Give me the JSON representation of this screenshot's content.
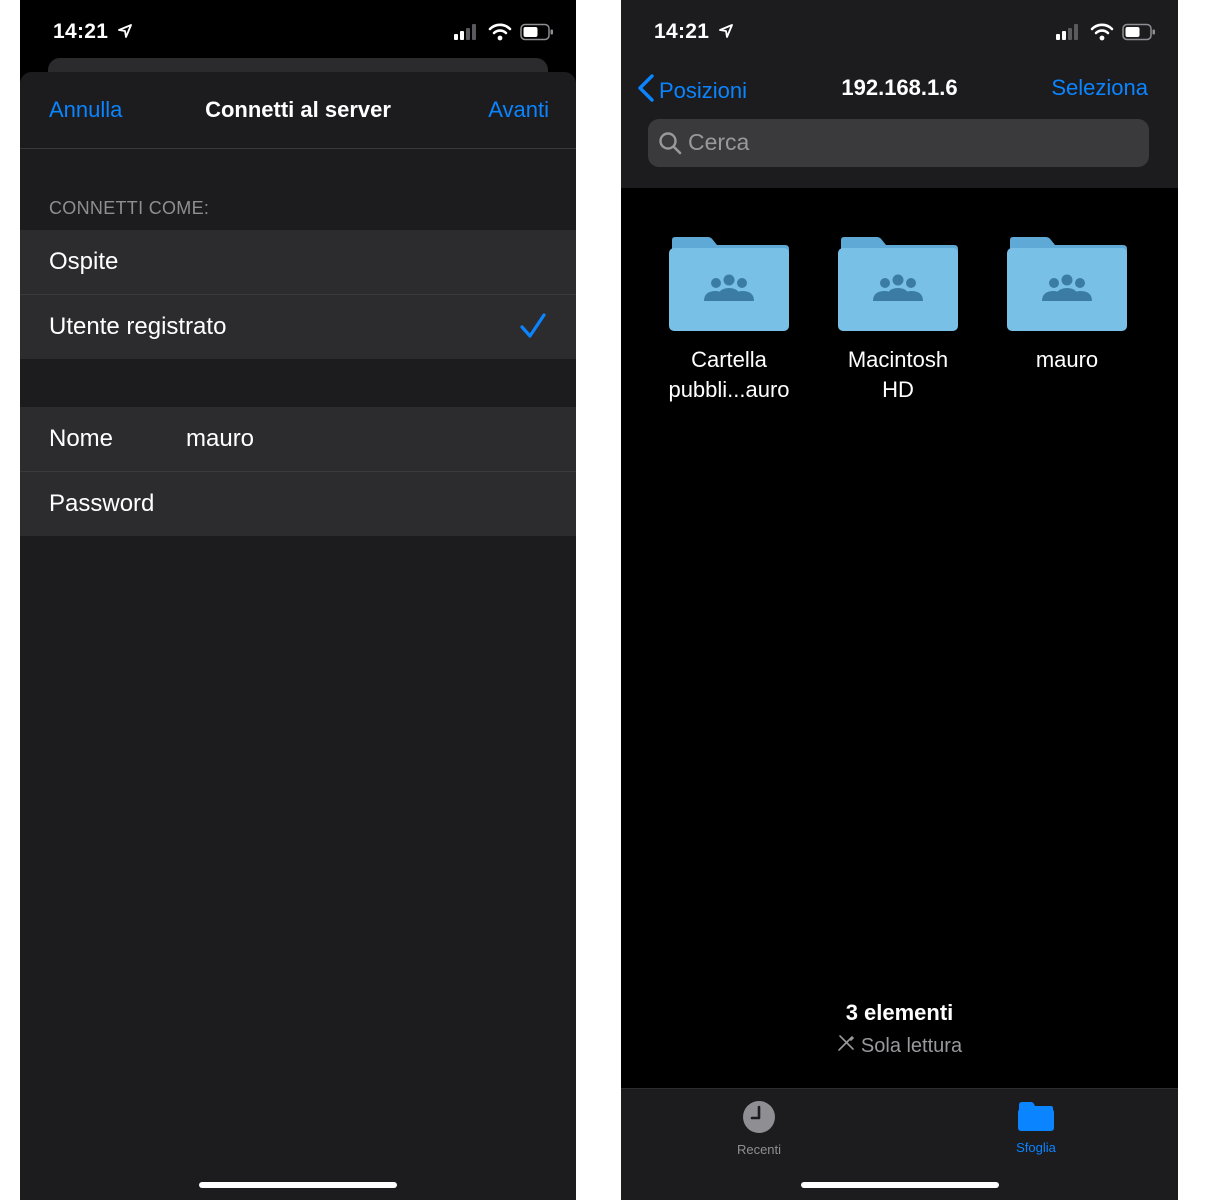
{
  "left_screen": {
    "status": {
      "time": "14:21"
    },
    "nav": {
      "cancel": "Annulla",
      "title": "Connetti al server",
      "next": "Avanti"
    },
    "section_header": "CONNETTI COME:",
    "options": [
      {
        "label": "Ospite",
        "selected": false
      },
      {
        "label": "Utente registrato",
        "selected": true
      }
    ],
    "credentials": {
      "name_label": "Nome",
      "name_value": "mauro",
      "password_label": "Password"
    },
    "colors": {
      "accent": "#0a84ff",
      "background": "#1c1c1e",
      "cell": "#2c2c2e"
    }
  },
  "right_screen": {
    "status": {
      "time": "14:21"
    },
    "nav": {
      "back": "Posizioni",
      "title": "192.168.1.6",
      "select": "Seleziona"
    },
    "search": {
      "placeholder": "Cerca"
    },
    "folders": [
      {
        "line1": "Cartella",
        "line2": "pubbli...auro",
        "icon": "shared-folder-icon"
      },
      {
        "line1": "Macintosh",
        "line2": "HD",
        "icon": "shared-folder-icon"
      },
      {
        "line1": "mauro",
        "line2": "",
        "icon": "shared-folder-icon"
      }
    ],
    "summary": {
      "count": "3 elementi",
      "read_only": "Sola lettura"
    },
    "tabs": [
      {
        "label": "Recenti",
        "icon": "clock-icon",
        "active": false
      },
      {
        "label": "Sfoglia",
        "icon": "folder-icon",
        "active": true
      }
    ],
    "colors": {
      "accent": "#0a84ff",
      "folder": "#79c0e6",
      "inactive_tab": "#8e8e93"
    }
  }
}
